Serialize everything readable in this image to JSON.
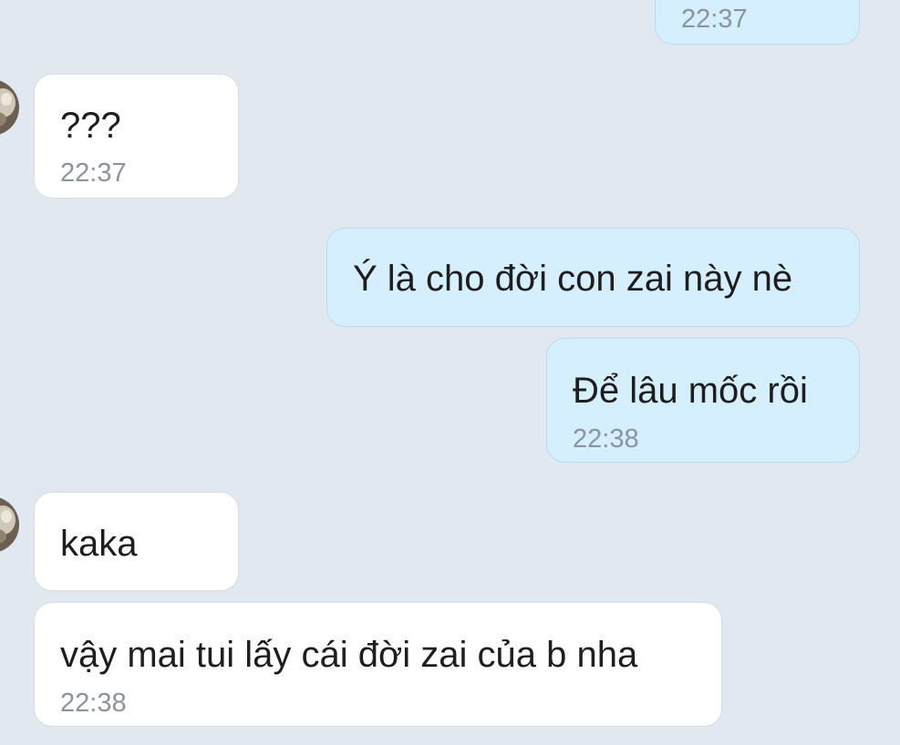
{
  "conversation": {
    "messages": [
      {
        "direction": "out",
        "text": "",
        "time": "22:37"
      },
      {
        "direction": "in",
        "text": "???",
        "time": "22:37"
      },
      {
        "direction": "out",
        "text": "Ý là cho đời con zai này nè",
        "time": ""
      },
      {
        "direction": "out",
        "text": "Để lâu mốc rồi",
        "time": "22:38"
      },
      {
        "direction": "in",
        "text": "kaka",
        "time": ""
      },
      {
        "direction": "in",
        "text": "vậy mai tui lấy cái đời zai của b nha",
        "time": "22:38"
      }
    ],
    "contact_avatar_icon": "avatar-icon"
  },
  "colors": {
    "background": "#e2e8f0",
    "incoming_bubble": "#ffffff",
    "outgoing_bubble": "#d5efff",
    "text": "#1e1e1e",
    "timestamp": "#8a949e"
  }
}
